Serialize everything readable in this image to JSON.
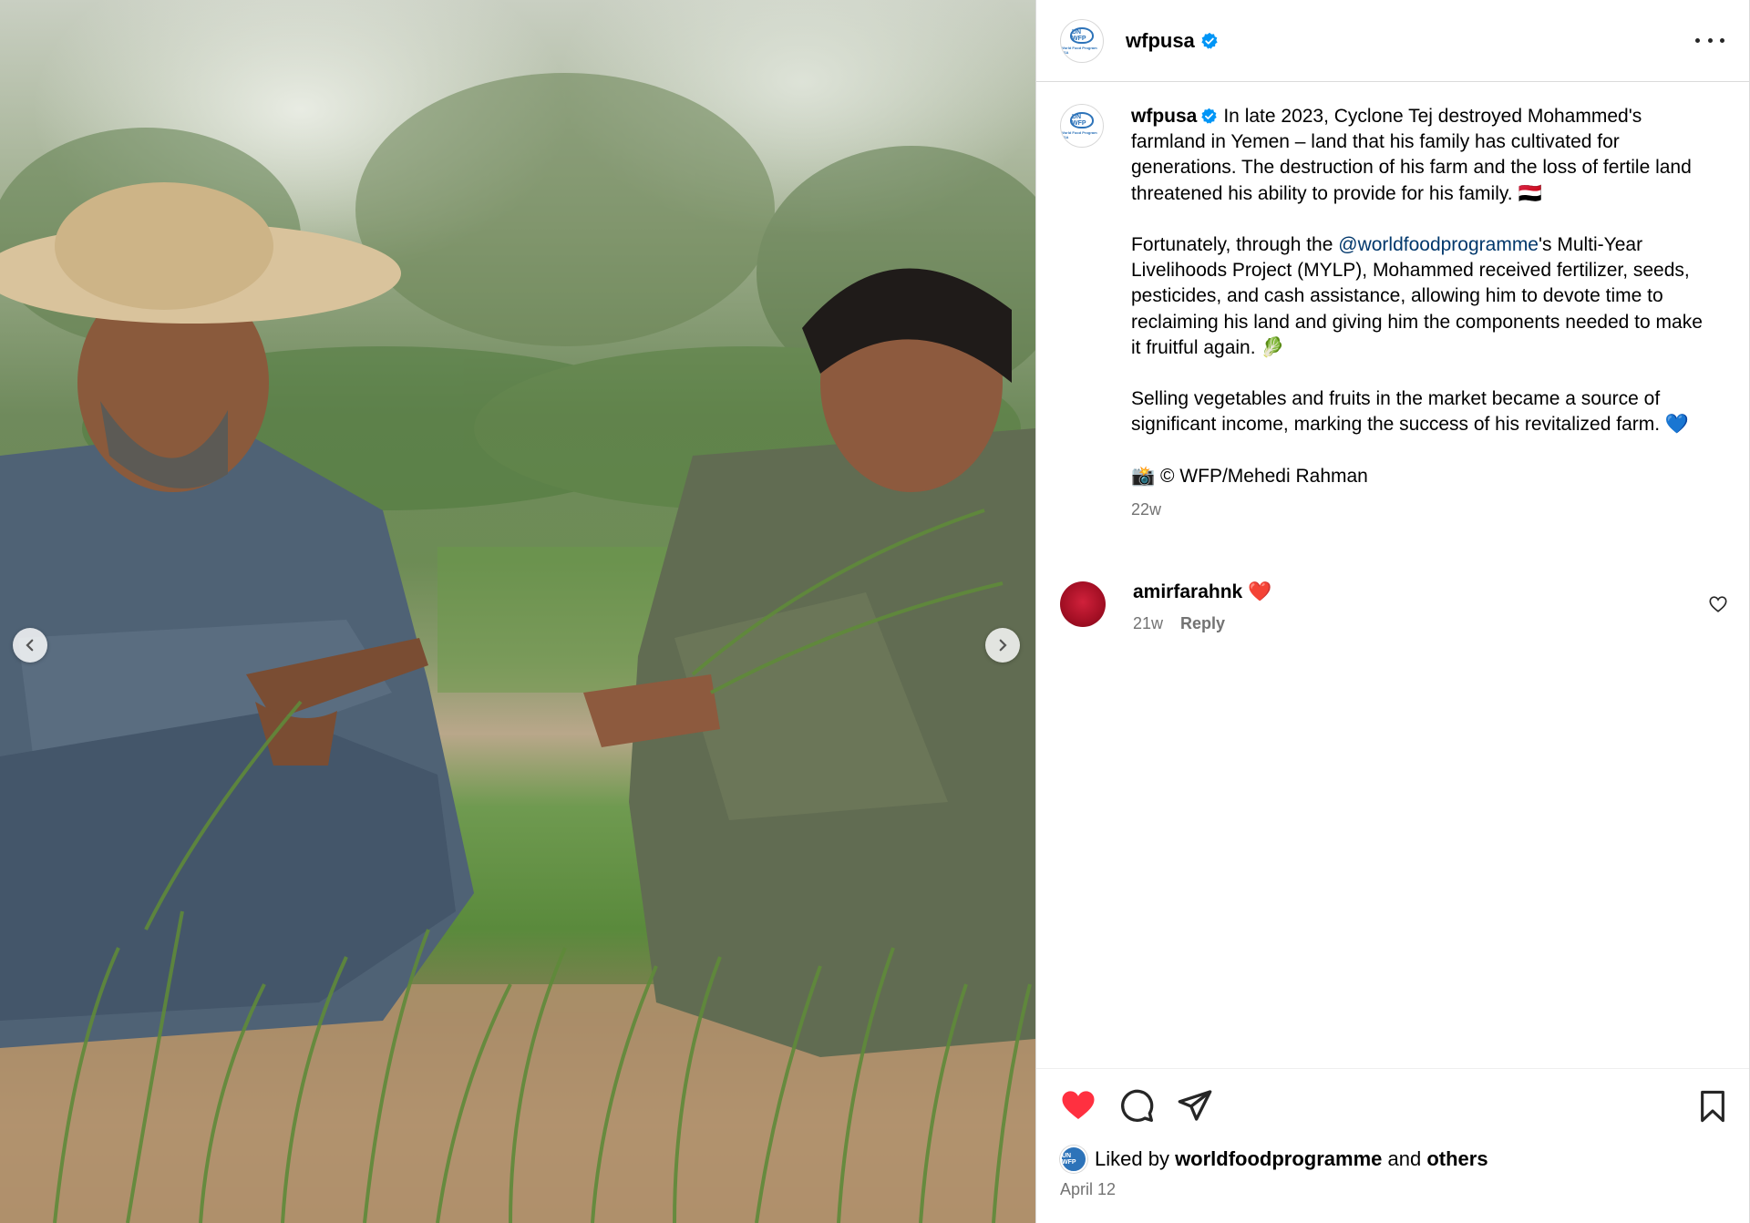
{
  "post": {
    "username": "wfpusa",
    "avatar_icon": "wfp-logo-icon",
    "avatar_text": "UN WFP",
    "avatar_subtext": "World Food Program USA"
  },
  "caption": {
    "username": "wfpusa",
    "para1": "In late 2023, Cyclone Tej destroyed Mohammed's farmland in Yemen – land that his family has cultivated for generations. The destruction of his farm and the loss of fertile land threatened his ability to provide for his family. 🇾🇪",
    "para2_before": "Fortunately, through the ",
    "mention": "@worldfoodprogramme",
    "para2_after": "'s Multi-Year Livelihoods Project (MYLP), Mohammed received fertilizer, seeds, pesticides, and cash assistance, allowing him to devote time to reclaiming his land and giving him the components needed to make it fruitful again. 🥬",
    "para3": "Selling vegetables and fruits in the market became a source of significant income, marking the success of his revitalized farm. 💙",
    "para4": "📸 © WFP/Mehedi Rahman",
    "time": "22w"
  },
  "comment": {
    "username": "amirfarahnk",
    "emoji": "❤️",
    "time": "21w",
    "reply_label": "Reply"
  },
  "footer": {
    "liked_prefix": "Liked by ",
    "liked_user": "worldfoodprogramme",
    "liked_and": " and ",
    "liked_others": "others",
    "date": "April 12"
  },
  "colors": {
    "like_red": "#ff3040",
    "verified_blue": "#0095f6",
    "mention_blue": "#00376b",
    "muted_text": "#737373"
  }
}
